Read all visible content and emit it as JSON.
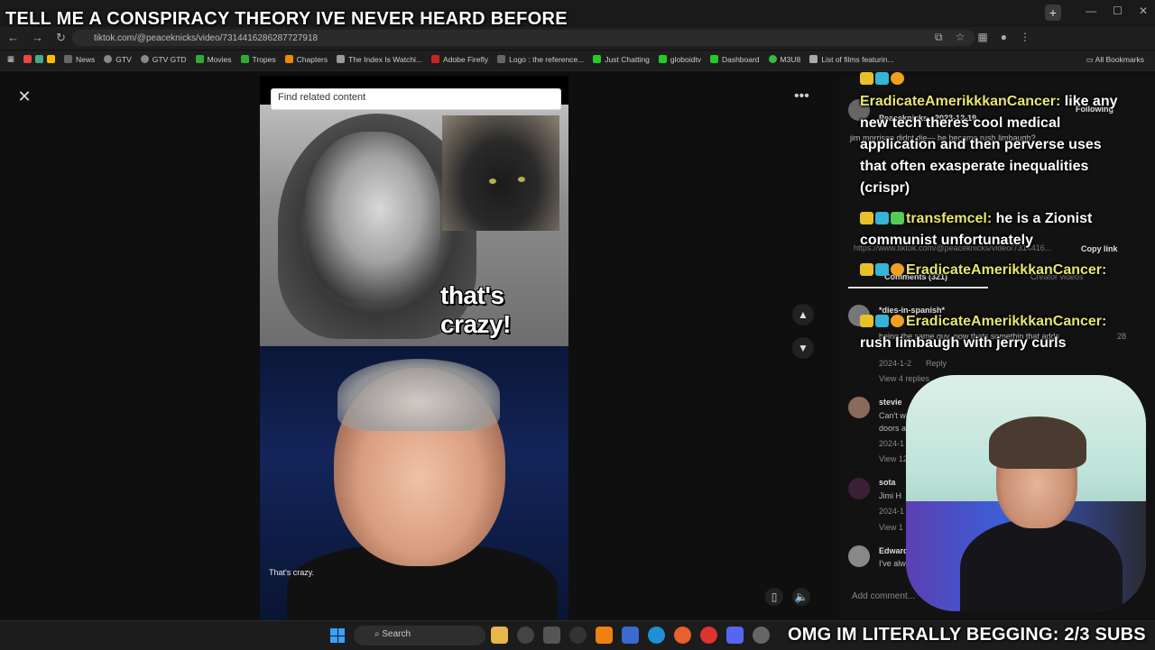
{
  "stream": {
    "title": "TELL ME A CONSPIRACY THEORY IVE NEVER HEARD BEFORE",
    "subs_banner": "OMG IM LITERALLY BEGGING: 2/3 SUBS"
  },
  "browser": {
    "url": "tiktok.com/@peaceknicks/video/7314416286287727918",
    "bookmarks": [
      "News",
      "GTV",
      "GTV GTD",
      "Movies",
      "Tropes",
      "Chapters",
      "The Index Is Watchi...",
      "Adobe Firefly",
      "Logo : the reference...",
      "Just Chatting",
      "globoidtv",
      "Dashboard",
      "M3U8",
      "List of films featurin..."
    ],
    "all_bookmarks": "All Bookmarks"
  },
  "video": {
    "search_placeholder": "Find related content",
    "caption_big": "that's crazy!",
    "subtitle": "That's crazy."
  },
  "panel": {
    "author": "Peaceknicks · 2023-12-19",
    "following": "Following",
    "desc": "jim morrison didnt die— he became rush limbaugh?",
    "link": "https://www.tiktok.com/@peaceknicks/video/7314416...",
    "copy_link": "Copy link",
    "tab_comments": "Comments (321)",
    "tab_creator": "Creator videos",
    "comments": [
      {
        "name": "*dies-in-spanish*",
        "text": "being the same guy, now thats somethin that adds",
        "date": "2024-1-2",
        "reply": "Reply",
        "likes": "28",
        "view": "View 4 replies"
      },
      {
        "name": "stevie",
        "text": "Can't wa",
        "text2": "doors a",
        "date": "2024-1",
        "view": "View 12"
      },
      {
        "name": "sota",
        "text": "Jimi H",
        "date": "2024-1",
        "view": "View 1"
      },
      {
        "name": "Edward",
        "text": "I've alw"
      }
    ],
    "add_comment": "Add comment..."
  },
  "chat": [
    {
      "user": "EradicateAmerikkkanCancer:",
      "lines": [
        "like any",
        "new tech theres cool medical",
        "application and then perverse uses",
        "that often exasperate inequalities",
        "(crispr)"
      ]
    },
    {
      "user": "transfemcel:",
      "lines": [
        "he is a Zionist",
        "communist unfortunately"
      ]
    },
    {
      "user": "EradicateAmerikkkanCancer:",
      "lines": []
    },
    {
      "user": "EradicateAmerikkkanCancer:",
      "lines": [
        "rush limbaugh with jerry curls"
      ]
    }
  ],
  "taskbar": {
    "search": "Search"
  }
}
